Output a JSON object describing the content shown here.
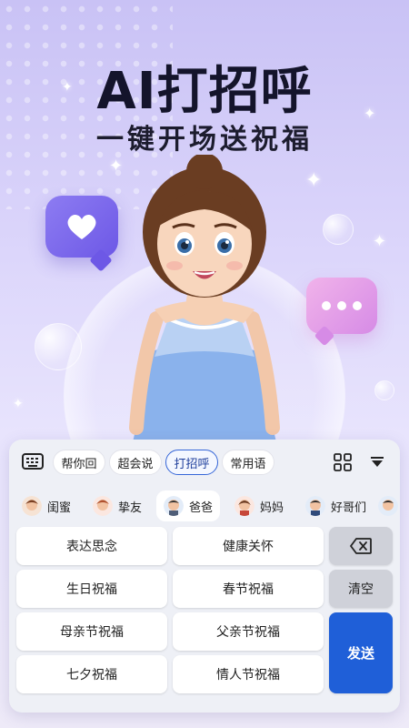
{
  "hero": {
    "title": "AI打招呼",
    "subtitle": "一键开场送祝福"
  },
  "toolbar": {
    "tabs": [
      "帮你回",
      "超会说",
      "打招呼",
      "常用语"
    ],
    "active_tab": "打招呼"
  },
  "contacts": [
    {
      "label": "闺蜜",
      "selected": false
    },
    {
      "label": "挚友",
      "selected": false
    },
    {
      "label": "爸爸",
      "selected": true
    },
    {
      "label": "妈妈",
      "selected": false
    },
    {
      "label": "好哥们",
      "selected": false
    }
  ],
  "phrases": [
    "表达思念",
    "健康关怀",
    "生日祝福",
    "春节祝福",
    "母亲节祝福",
    "父亲节祝福",
    "七夕祝福",
    "情人节祝福"
  ],
  "actions": {
    "clear_label": "清空",
    "send_label": "发送"
  },
  "colors": {
    "accent": "#1f5fd8",
    "title": "#14142b"
  }
}
